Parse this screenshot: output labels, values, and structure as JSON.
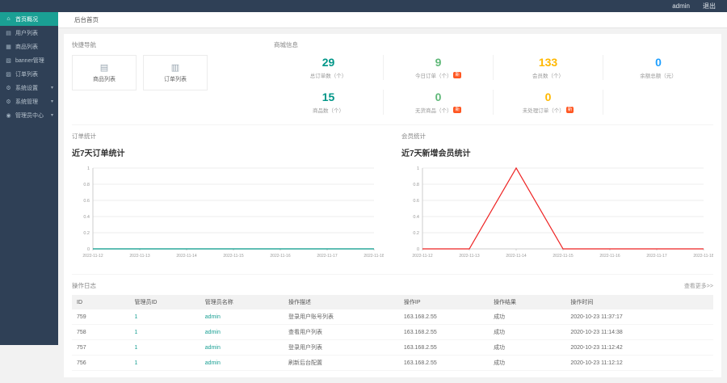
{
  "colors": {
    "accent": "#1aa094",
    "header_bg": "#2f4056",
    "badge": "#ff5722"
  },
  "topbar": {
    "username": "admin",
    "logout_label": "退出"
  },
  "tabbar": {
    "active_tab": "后台首页"
  },
  "sidebar": {
    "items": [
      {
        "name": "home",
        "icon": "home-icon",
        "label": "首页概况",
        "active": true,
        "has_children": false
      },
      {
        "name": "users",
        "icon": "user-list-icon",
        "label": "用户列表",
        "active": false,
        "has_children": false
      },
      {
        "name": "goods",
        "icon": "goods-list-icon",
        "label": "商品列表",
        "active": false,
        "has_children": false
      },
      {
        "name": "banner",
        "icon": "banner-icon",
        "label": "banner管理",
        "active": false,
        "has_children": false
      },
      {
        "name": "orders",
        "icon": "order-list-icon",
        "label": "订单列表",
        "active": false,
        "has_children": false
      },
      {
        "name": "system-settings",
        "icon": "settings-icon",
        "label": "系统设置",
        "active": false,
        "has_children": true
      },
      {
        "name": "system-management",
        "icon": "system-icon",
        "label": "系统管理",
        "active": false,
        "has_children": true
      },
      {
        "name": "admin-center",
        "icon": "admin-icon",
        "label": "管理员中心",
        "active": false,
        "has_children": true
      }
    ]
  },
  "quick_nav": {
    "title": "快捷导航",
    "items": [
      {
        "name": "goods",
        "icon": "goods-doc-icon",
        "label": "商品列表"
      },
      {
        "name": "orders",
        "icon": "order-doc-icon",
        "label": "订单列表"
      }
    ]
  },
  "stats": {
    "title": "商城信息",
    "cells": [
      {
        "name": "total-orders",
        "value": "29",
        "label": "总订单数（个）",
        "color": "#009688"
      },
      {
        "name": "today-orders",
        "value": "9",
        "label": "今日订单（个）",
        "color": "#5FB878",
        "badge": "新"
      },
      {
        "name": "members",
        "value": "133",
        "label": "会员数（个）",
        "color": "#FFB800"
      },
      {
        "name": "balance",
        "value": "0",
        "label": "余额总额（元）",
        "color": "#1E9FFF"
      },
      {
        "name": "goods-count",
        "value": "15",
        "label": "商品数（个）",
        "color": "#009688"
      },
      {
        "name": "out-of-stock",
        "value": "0",
        "label": "无货商品（个）",
        "color": "#5FB878",
        "badge": "新"
      },
      {
        "name": "pending-orders",
        "value": "0",
        "label": "未处理订单（个）",
        "color": "#FFB800",
        "badge": "新"
      }
    ]
  },
  "chart_data": [
    {
      "type": "line",
      "section": "订单统计",
      "title": "近7天订单统计",
      "x": [
        "2022-11-12",
        "2022-11-13",
        "2022-11-14",
        "2022-11-15",
        "2022-11-16",
        "2022-11-17",
        "2022-11-18"
      ],
      "values": [
        0,
        0,
        0,
        0,
        0,
        0,
        0
      ],
      "ylim": [
        0,
        1
      ],
      "yticks": [
        0,
        0.2,
        0.4,
        0.6,
        0.8,
        1
      ],
      "color": "#009688",
      "grid": true,
      "legend": "none"
    },
    {
      "type": "line",
      "section": "会员统计",
      "title": "近7天新增会员统计",
      "x": [
        "2022-11-12",
        "2022-11-13",
        "2022-11-14",
        "2022-11-15",
        "2022-11-16",
        "2022-11-17",
        "2022-11-18"
      ],
      "values": [
        0,
        0,
        1,
        0,
        0,
        0,
        0
      ],
      "ylim": [
        0,
        1
      ],
      "yticks": [
        0,
        0.2,
        0.4,
        0.6,
        0.8,
        1
      ],
      "color": "#ee2222",
      "grid": true,
      "legend": "none"
    }
  ],
  "logs": {
    "title": "操作日志",
    "more_label": "查看更多>>",
    "columns": [
      "ID",
      "管理员ID",
      "管理员名称",
      "操作描述",
      "操作IP",
      "操作结果",
      "操作时间"
    ],
    "link_columns": [
      1,
      2
    ],
    "rows": [
      [
        "759",
        "1",
        "admin",
        "登录用户账号列表",
        "163.168.2.55",
        "成功",
        "2020-10-23 11:37:17"
      ],
      [
        "758",
        "1",
        "admin",
        "查看用户列表",
        "163.168.2.55",
        "成功",
        "2020-10-23 11:14:38"
      ],
      [
        "757",
        "1",
        "admin",
        "登录用户列表",
        "163.168.2.55",
        "成功",
        "2020-10-23 11:12:42"
      ],
      [
        "756",
        "1",
        "admin",
        "刷新后台配置",
        "163.168.2.55",
        "成功",
        "2020-10-23 11:12:12"
      ]
    ]
  }
}
